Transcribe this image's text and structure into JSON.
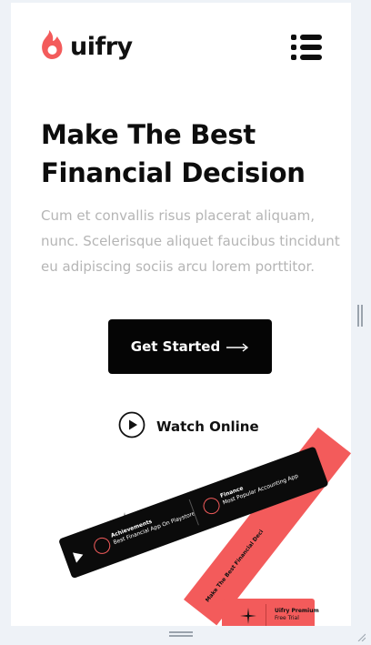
{
  "brand": {
    "name": "uifry",
    "accent_color": "#f35b5b",
    "logo_icon": "flame-icon"
  },
  "header": {
    "menu_icon": "hamburger-menu-icon"
  },
  "hero": {
    "title_line1": "Make The Best",
    "title_line2": "Financial Decision",
    "description": "Cum et convallis risus placerat aliquam, nunc. Scelerisque aliquet faucibus tincidunt eu adipiscing sociis arcu lorem porttitor.",
    "cta_label": "Get Started",
    "cta_icon": "arrow-right-icon",
    "watch_label": "Watch Online",
    "watch_icon": "play-circle-icon"
  },
  "illustration": {
    "card1_title": "Achievements",
    "card1_sub": "Best Financial App On Playstore",
    "card2_title": "Finance",
    "card2_sub": "Most Popular Accounting App",
    "red_text": "Make The Best Financial Deci",
    "premium_title": "Uifry Premium",
    "premium_sub": "Free Trial"
  }
}
